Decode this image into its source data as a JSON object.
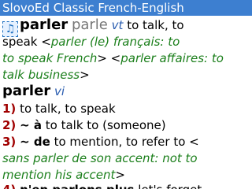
{
  "app": {
    "title": "SlovoEd Classic French-English"
  },
  "entry1": {
    "headword": "parler",
    "headword_gray": "parle",
    "pos": "vt",
    "gloss": "to talk, to",
    "line2_a": "speak <",
    "line2_ex": "parler (le) français: to",
    "line3_ex_a": "to speak French",
    "line3_b": "> <",
    "line3_ex_b": "parler affaires: to",
    "line4_ex": "talk business",
    "line4_b": ">"
  },
  "entry2": {
    "headword": "parler",
    "pos": "vi",
    "senses": [
      {
        "num": "1)",
        "text": "to talk, to speak"
      },
      {
        "num": "2)",
        "phrase": "~ à",
        "text": "to talk to (someone)"
      },
      {
        "num": "3)",
        "phrase": "~ de",
        "text": "to mention, to refer to <"
      }
    ],
    "ex_line1": "sans parler de son accent: not to",
    "ex_line2": "mention his accent",
    "ex_line2_tail": ">",
    "sense4_num": "4)",
    "sense4_phrase": "n'en parlons plus",
    "sense4_text": "let's forget"
  },
  "icons": {
    "speaker": "speaker-icon"
  }
}
